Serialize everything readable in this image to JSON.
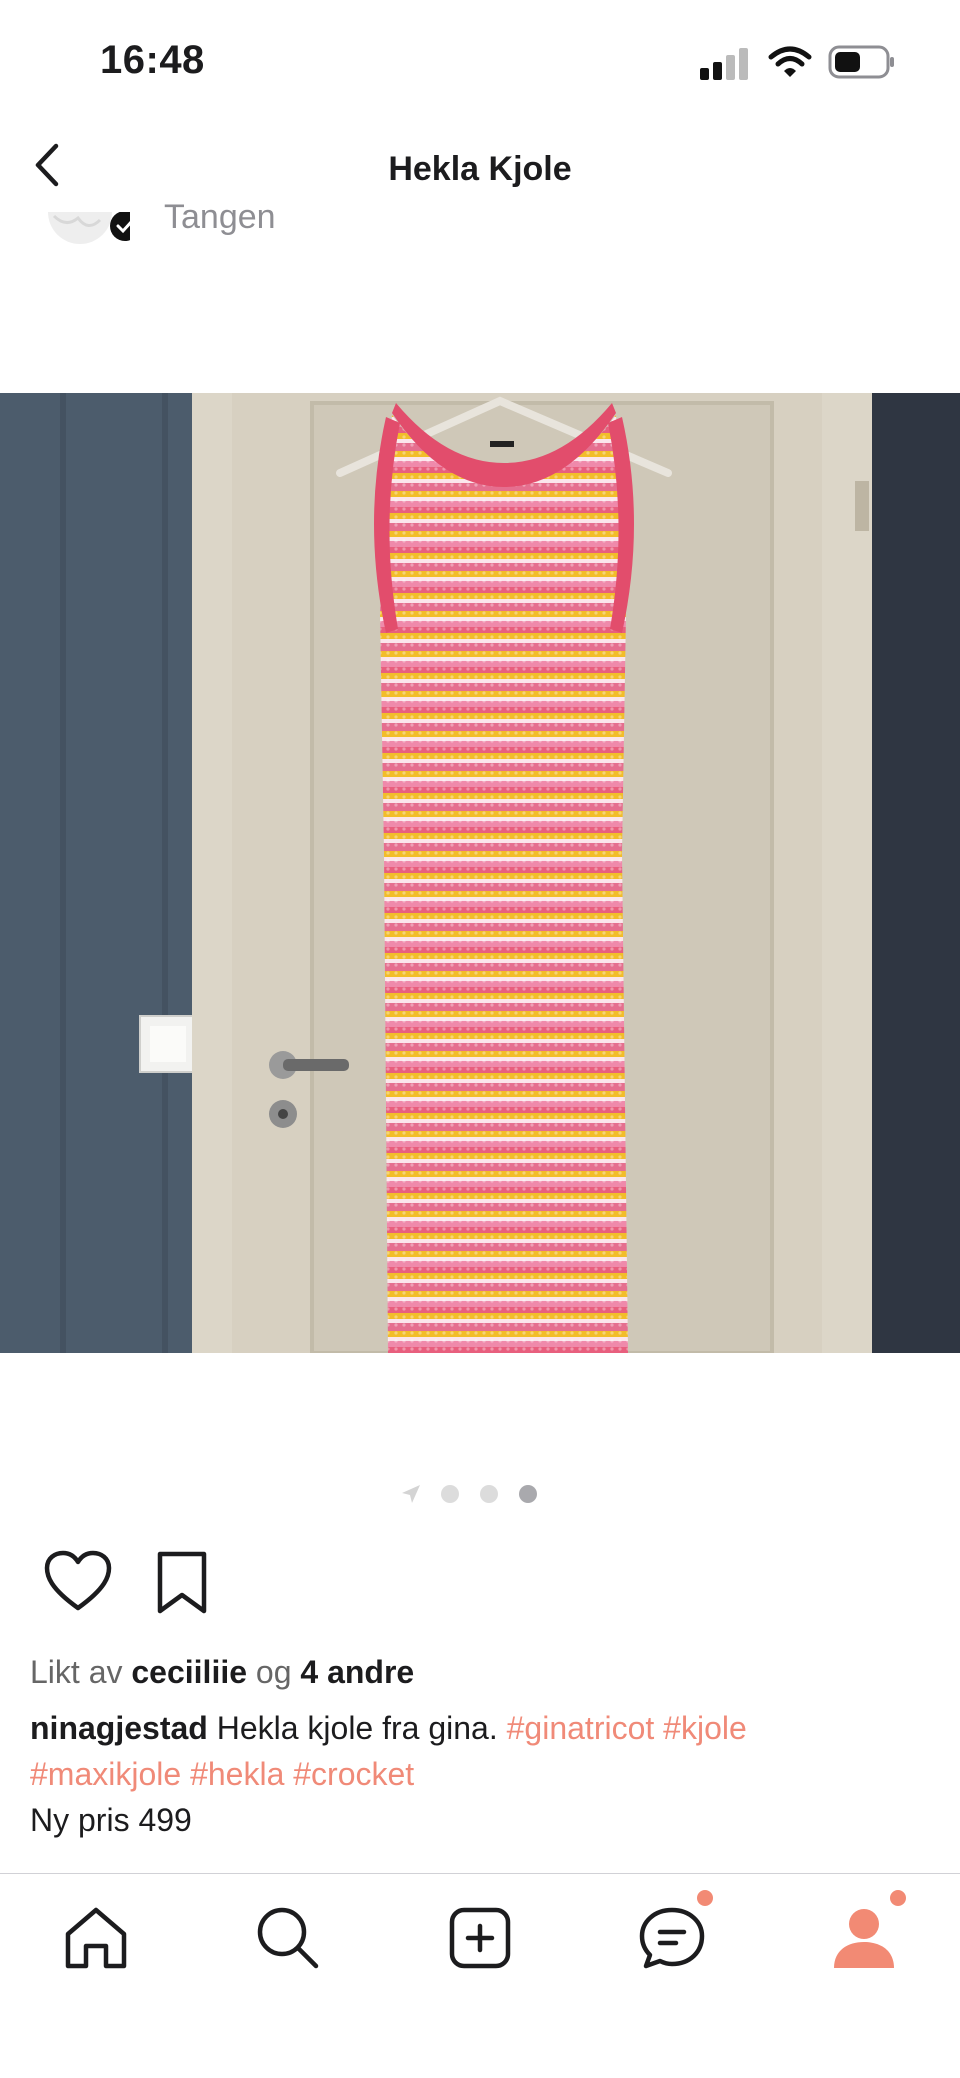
{
  "status_bar": {
    "time": "16:48"
  },
  "nav": {
    "title": "Hekla Kjole"
  },
  "author_peek": {
    "name": "Tangen"
  },
  "carousel": {
    "count": 4,
    "active_index": 3
  },
  "likes": {
    "prefix": "Likt av",
    "user": "ceciiliie",
    "joiner": "og",
    "others": "4 andre"
  },
  "caption": {
    "user": "ninagjestad",
    "text": "Hekla kjole fra gina.",
    "tags": [
      "#ginatricot",
      "#kjole",
      "#maxikjole",
      "#hekla",
      "#crocket"
    ]
  },
  "price": {
    "text": "Ny pris 499"
  },
  "tab_bar": {
    "items": [
      "home-icon",
      "search-icon",
      "add-icon",
      "messages-icon",
      "profile-icon"
    ],
    "accent": "#f28a74"
  }
}
